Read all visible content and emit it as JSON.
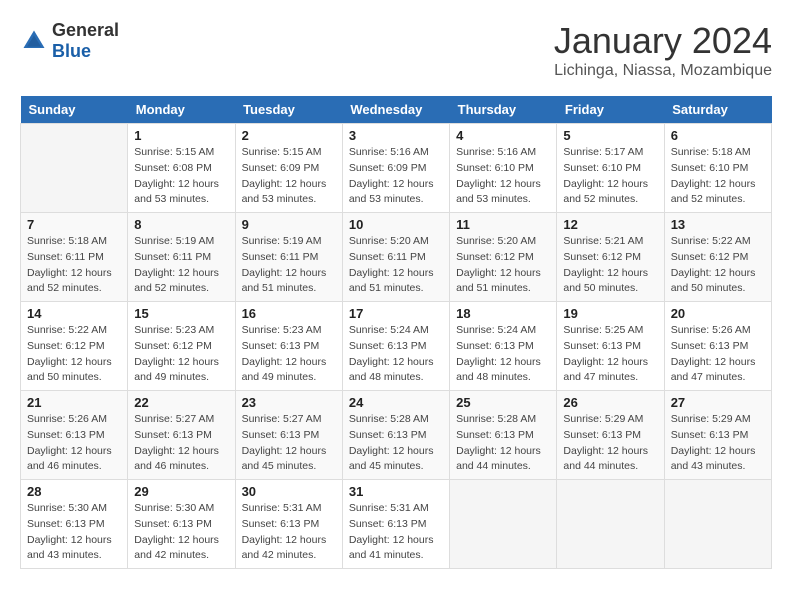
{
  "logo": {
    "general": "General",
    "blue": "Blue"
  },
  "title": "January 2024",
  "subtitle": "Lichinga, Niassa, Mozambique",
  "days_of_week": [
    "Sunday",
    "Monday",
    "Tuesday",
    "Wednesday",
    "Thursday",
    "Friday",
    "Saturday"
  ],
  "weeks": [
    [
      {
        "day": "",
        "sunrise": "",
        "sunset": "",
        "daylight": ""
      },
      {
        "day": "1",
        "sunrise": "Sunrise: 5:15 AM",
        "sunset": "Sunset: 6:08 PM",
        "daylight": "Daylight: 12 hours and 53 minutes."
      },
      {
        "day": "2",
        "sunrise": "Sunrise: 5:15 AM",
        "sunset": "Sunset: 6:09 PM",
        "daylight": "Daylight: 12 hours and 53 minutes."
      },
      {
        "day": "3",
        "sunrise": "Sunrise: 5:16 AM",
        "sunset": "Sunset: 6:09 PM",
        "daylight": "Daylight: 12 hours and 53 minutes."
      },
      {
        "day": "4",
        "sunrise": "Sunrise: 5:16 AM",
        "sunset": "Sunset: 6:10 PM",
        "daylight": "Daylight: 12 hours and 53 minutes."
      },
      {
        "day": "5",
        "sunrise": "Sunrise: 5:17 AM",
        "sunset": "Sunset: 6:10 PM",
        "daylight": "Daylight: 12 hours and 52 minutes."
      },
      {
        "day": "6",
        "sunrise": "Sunrise: 5:18 AM",
        "sunset": "Sunset: 6:10 PM",
        "daylight": "Daylight: 12 hours and 52 minutes."
      }
    ],
    [
      {
        "day": "7",
        "sunrise": "Sunrise: 5:18 AM",
        "sunset": "Sunset: 6:11 PM",
        "daylight": "Daylight: 12 hours and 52 minutes."
      },
      {
        "day": "8",
        "sunrise": "Sunrise: 5:19 AM",
        "sunset": "Sunset: 6:11 PM",
        "daylight": "Daylight: 12 hours and 52 minutes."
      },
      {
        "day": "9",
        "sunrise": "Sunrise: 5:19 AM",
        "sunset": "Sunset: 6:11 PM",
        "daylight": "Daylight: 12 hours and 51 minutes."
      },
      {
        "day": "10",
        "sunrise": "Sunrise: 5:20 AM",
        "sunset": "Sunset: 6:11 PM",
        "daylight": "Daylight: 12 hours and 51 minutes."
      },
      {
        "day": "11",
        "sunrise": "Sunrise: 5:20 AM",
        "sunset": "Sunset: 6:12 PM",
        "daylight": "Daylight: 12 hours and 51 minutes."
      },
      {
        "day": "12",
        "sunrise": "Sunrise: 5:21 AM",
        "sunset": "Sunset: 6:12 PM",
        "daylight": "Daylight: 12 hours and 50 minutes."
      },
      {
        "day": "13",
        "sunrise": "Sunrise: 5:22 AM",
        "sunset": "Sunset: 6:12 PM",
        "daylight": "Daylight: 12 hours and 50 minutes."
      }
    ],
    [
      {
        "day": "14",
        "sunrise": "Sunrise: 5:22 AM",
        "sunset": "Sunset: 6:12 PM",
        "daylight": "Daylight: 12 hours and 50 minutes."
      },
      {
        "day": "15",
        "sunrise": "Sunrise: 5:23 AM",
        "sunset": "Sunset: 6:12 PM",
        "daylight": "Daylight: 12 hours and 49 minutes."
      },
      {
        "day": "16",
        "sunrise": "Sunrise: 5:23 AM",
        "sunset": "Sunset: 6:13 PM",
        "daylight": "Daylight: 12 hours and 49 minutes."
      },
      {
        "day": "17",
        "sunrise": "Sunrise: 5:24 AM",
        "sunset": "Sunset: 6:13 PM",
        "daylight": "Daylight: 12 hours and 48 minutes."
      },
      {
        "day": "18",
        "sunrise": "Sunrise: 5:24 AM",
        "sunset": "Sunset: 6:13 PM",
        "daylight": "Daylight: 12 hours and 48 minutes."
      },
      {
        "day": "19",
        "sunrise": "Sunrise: 5:25 AM",
        "sunset": "Sunset: 6:13 PM",
        "daylight": "Daylight: 12 hours and 47 minutes."
      },
      {
        "day": "20",
        "sunrise": "Sunrise: 5:26 AM",
        "sunset": "Sunset: 6:13 PM",
        "daylight": "Daylight: 12 hours and 47 minutes."
      }
    ],
    [
      {
        "day": "21",
        "sunrise": "Sunrise: 5:26 AM",
        "sunset": "Sunset: 6:13 PM",
        "daylight": "Daylight: 12 hours and 46 minutes."
      },
      {
        "day": "22",
        "sunrise": "Sunrise: 5:27 AM",
        "sunset": "Sunset: 6:13 PM",
        "daylight": "Daylight: 12 hours and 46 minutes."
      },
      {
        "day": "23",
        "sunrise": "Sunrise: 5:27 AM",
        "sunset": "Sunset: 6:13 PM",
        "daylight": "Daylight: 12 hours and 45 minutes."
      },
      {
        "day": "24",
        "sunrise": "Sunrise: 5:28 AM",
        "sunset": "Sunset: 6:13 PM",
        "daylight": "Daylight: 12 hours and 45 minutes."
      },
      {
        "day": "25",
        "sunrise": "Sunrise: 5:28 AM",
        "sunset": "Sunset: 6:13 PM",
        "daylight": "Daylight: 12 hours and 44 minutes."
      },
      {
        "day": "26",
        "sunrise": "Sunrise: 5:29 AM",
        "sunset": "Sunset: 6:13 PM",
        "daylight": "Daylight: 12 hours and 44 minutes."
      },
      {
        "day": "27",
        "sunrise": "Sunrise: 5:29 AM",
        "sunset": "Sunset: 6:13 PM",
        "daylight": "Daylight: 12 hours and 43 minutes."
      }
    ],
    [
      {
        "day": "28",
        "sunrise": "Sunrise: 5:30 AM",
        "sunset": "Sunset: 6:13 PM",
        "daylight": "Daylight: 12 hours and 43 minutes."
      },
      {
        "day": "29",
        "sunrise": "Sunrise: 5:30 AM",
        "sunset": "Sunset: 6:13 PM",
        "daylight": "Daylight: 12 hours and 42 minutes."
      },
      {
        "day": "30",
        "sunrise": "Sunrise: 5:31 AM",
        "sunset": "Sunset: 6:13 PM",
        "daylight": "Daylight: 12 hours and 42 minutes."
      },
      {
        "day": "31",
        "sunrise": "Sunrise: 5:31 AM",
        "sunset": "Sunset: 6:13 PM",
        "daylight": "Daylight: 12 hours and 41 minutes."
      },
      {
        "day": "",
        "sunrise": "",
        "sunset": "",
        "daylight": ""
      },
      {
        "day": "",
        "sunrise": "",
        "sunset": "",
        "daylight": ""
      },
      {
        "day": "",
        "sunrise": "",
        "sunset": "",
        "daylight": ""
      }
    ]
  ]
}
